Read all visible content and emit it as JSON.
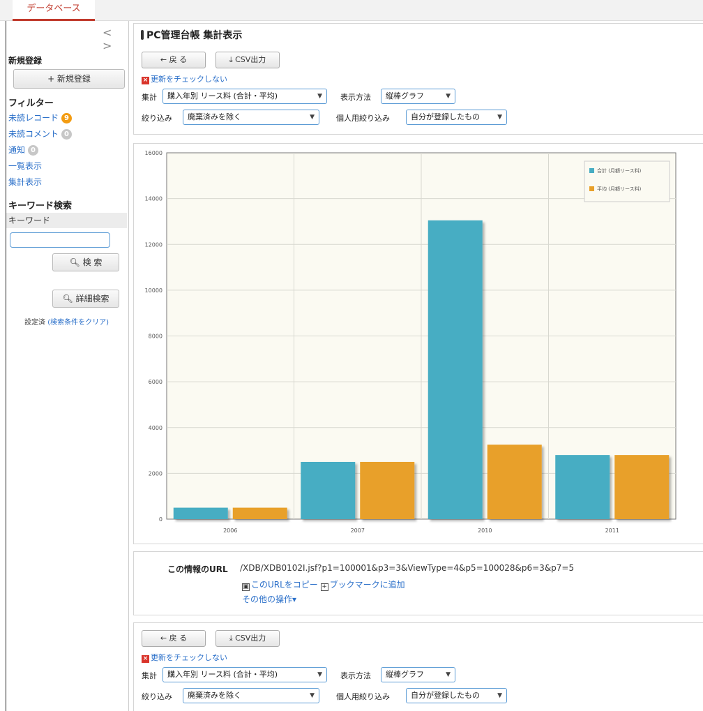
{
  "header": {
    "tab": "データベース"
  },
  "sidebar": {
    "nav": "< >",
    "new_heading": "新規登録",
    "new_button": "+ 新規登録",
    "filter_heading": "フィルター",
    "unread_records": "未読レコード",
    "unread_records_count": "9",
    "unread_comments": "未読コメント",
    "unread_comments_count": "0",
    "notices": "通知",
    "notices_count": "0",
    "list_view": "一覧表示",
    "summary_view": "集計表示",
    "keyword_heading": "キーワード検索",
    "keyword_label": "キーワード",
    "search_button": "検 索",
    "advanced_button": "詳細検索",
    "settings_prefix": "設定済",
    "clear_link": "(検索条件をクリア)"
  },
  "main": {
    "title": "PC管理台帳 集計表示",
    "back_button": "← 戻 る",
    "csv_button": "⤓ CSV出力",
    "nocheck_label": "更新をチェックしない",
    "aggregate_label": "集計",
    "aggregate_value": "購入年別 リース料 (合計・平均)",
    "display_label": "表示方法",
    "display_value": "縦棒グラフ",
    "narrow_label": "絞り込み",
    "narrow_value": "廃棄済みを除く",
    "personal_label": "個人用絞り込み",
    "personal_value": "自分が登録したもの",
    "url_label": "この情報のURL",
    "url_value": "/XDB/XDB0102I.jsf?p1=100001&p3=3&ViewType=4&p5=100028&p6=3&p7=5",
    "copy_url": "このURLをコピー",
    "add_bookmark": "ブックマークに追加",
    "other_ops": "その他の操作▾"
  },
  "chart_data": {
    "type": "bar",
    "categories": [
      "2006",
      "2007",
      "2010",
      "2011"
    ],
    "series": [
      {
        "name": "合計 (月額リース料)",
        "values": [
          500,
          2500,
          13050,
          2800
        ],
        "color": "#47adc3"
      },
      {
        "name": "平均 (月額リース料)",
        "values": [
          500,
          2500,
          3250,
          2800
        ],
        "color": "#e8a02a"
      }
    ],
    "ylim": [
      0,
      16000
    ],
    "yticks": [
      "0",
      "2000",
      "4000",
      "6000",
      "8000",
      "10000",
      "12000",
      "14000",
      "16000"
    ],
    "grid": true,
    "legend": "top-right"
  }
}
